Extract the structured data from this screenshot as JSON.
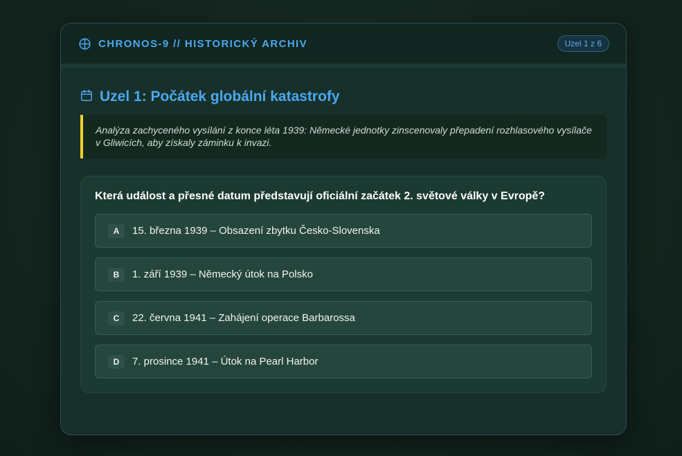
{
  "header": {
    "title": "CHRONOS-9 // HISTORICKÝ ARCHIV",
    "icon": "crosshair-icon",
    "node_badge": "Uzel 1 z 6"
  },
  "section": {
    "icon": "calendar-icon",
    "title": "Uzel 1: Počátek globální katastrofy",
    "intel": "Analýza zachyceného vysílání z konce léta 1939: Německé jednotky zinscenovaly přepadení rozhlasového vysílače v Gliwicích, aby získaly záminku k invazi."
  },
  "question": {
    "text": "Která událost a přesné datum představují oficiální začátek 2. světové války v Evropě?",
    "options": [
      {
        "letter": "A",
        "text": "15. března 1939 – Obsazení zbytku Česko-Slovenska"
      },
      {
        "letter": "B",
        "text": "1. září 1939 – Německý útok na Polsko"
      },
      {
        "letter": "C",
        "text": "22. června 1941 – Zahájení operace Barbarossa"
      },
      {
        "letter": "D",
        "text": "7. prosince 1941 – Útok na Pearl Harbor"
      }
    ]
  },
  "colors": {
    "accent": "#4aa8f0",
    "highlight_bar": "#f2cf2a",
    "background": "#14261f"
  }
}
